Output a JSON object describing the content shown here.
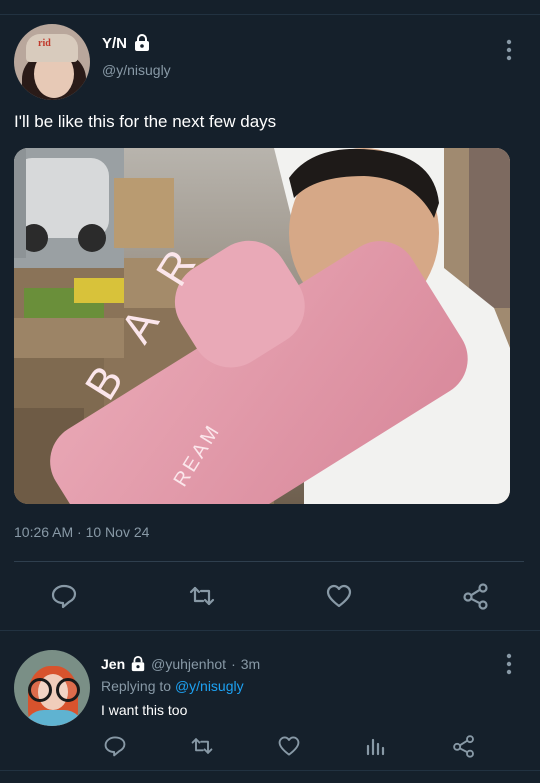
{
  "tweet": {
    "display_name": "Y/N",
    "handle": "@y/nisugly",
    "text": "I'll be like this for the next few days",
    "timestamp": "10:26 AM · 10 Nov 24",
    "media": {
      "overlay_text_1": "B A R",
      "overlay_text_2": "REAM"
    },
    "avatar_hat_text": "rid"
  },
  "actions": [
    "reply-icon",
    "retweet-icon",
    "like-icon",
    "share-icon"
  ],
  "reply": {
    "display_name": "Jen",
    "handle": "@yuhjenhot",
    "separator": "·",
    "age": "3m",
    "replying_prefix": "Replying to",
    "replying_to": "@y/nisugly",
    "text": "I want this too"
  },
  "reply_actions": [
    "reply-icon",
    "retweet-icon",
    "like-icon",
    "analytics-icon",
    "share-icon"
  ],
  "colors": {
    "background": "#15202b",
    "secondary_text": "#8899a6",
    "link": "#1da1f2",
    "divider": "#2f3f4e"
  }
}
